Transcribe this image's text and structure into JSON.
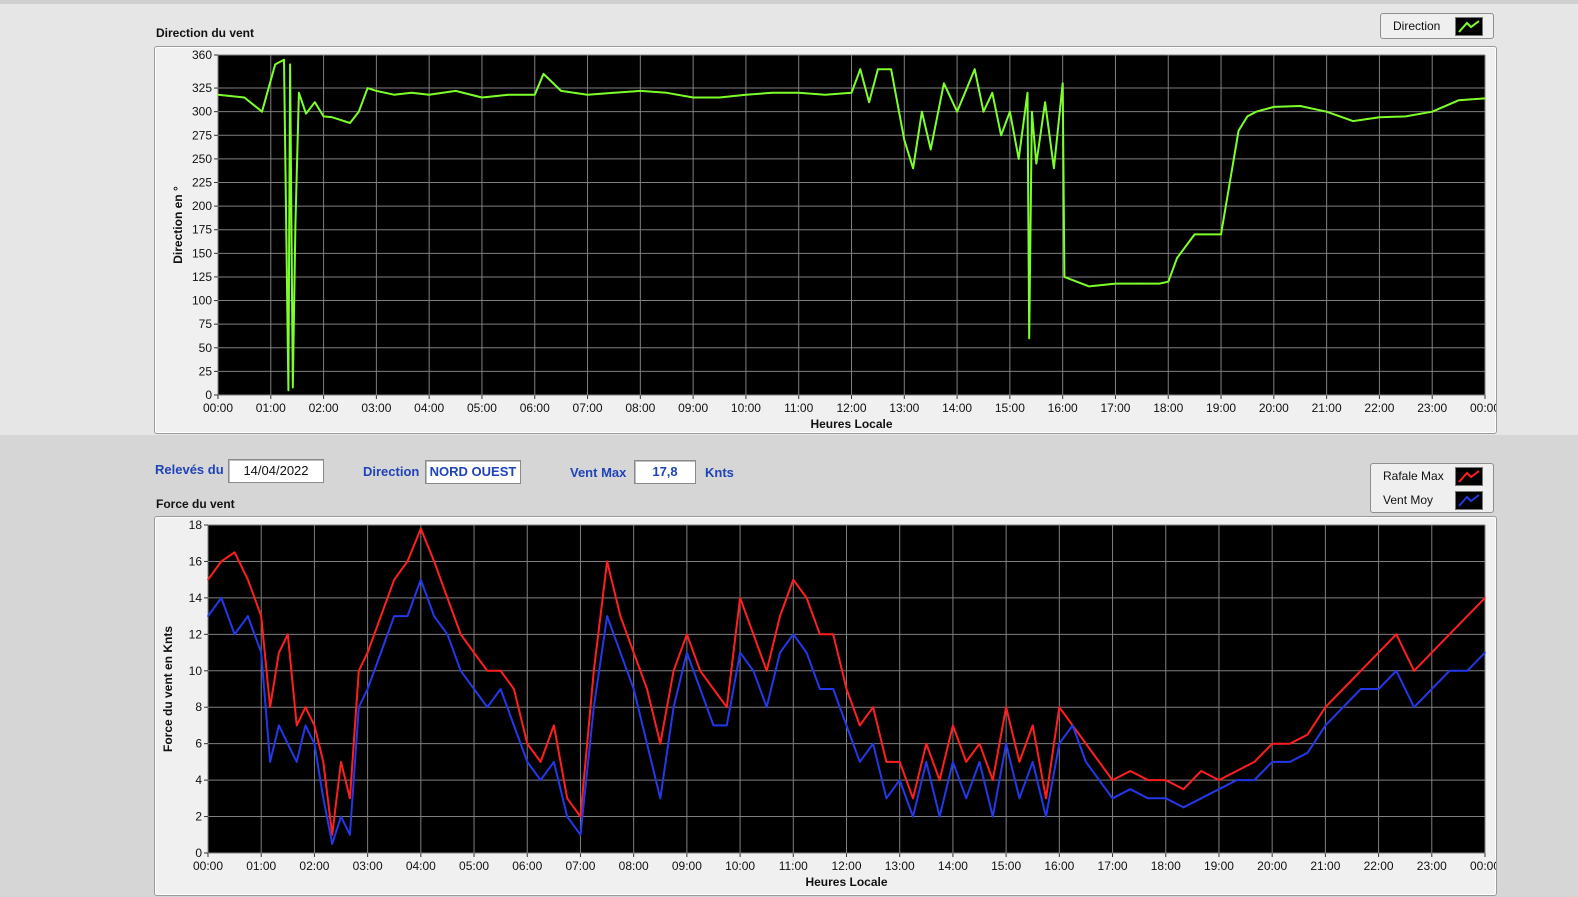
{
  "colors": {
    "direction": "#7dff2a",
    "rafale": "#ff1f1f",
    "moy": "#2338e8",
    "plot_bg": "#000000",
    "grid": "#7f7f7f",
    "label_blue": "#1f43b8"
  },
  "panels": {
    "direction_title": "Direction du vent",
    "force_title": "Force du vent"
  },
  "info": {
    "releves_label": "Relevés du",
    "date": "14/04/2022",
    "direction_label": "Direction",
    "direction_value": "NORD OUEST",
    "ventmax_label": "Vent Max",
    "ventmax_value": "17,8",
    "ventmax_unit": "Knts"
  },
  "legends": {
    "direction": {
      "label": "Direction",
      "icon": "line-swatch-icon"
    },
    "rafale": {
      "label": "Rafale Max",
      "icon": "line-swatch-icon"
    },
    "moy": {
      "label": "Vent Moy",
      "icon": "line-swatch-icon"
    }
  },
  "chart_data": [
    {
      "type": "line",
      "title": "Direction du vent",
      "xlabel": "Heures Locale",
      "ylabel": "Direction en °",
      "xlim": [
        "00:00",
        "24:00"
      ],
      "ylim": [
        0,
        360
      ],
      "grid": true,
      "legend_position": "top-right",
      "x_ticks": [
        "00:00",
        "01:00",
        "02:00",
        "03:00",
        "04:00",
        "05:00",
        "06:00",
        "07:00",
        "08:00",
        "09:00",
        "10:00",
        "11:00",
        "12:00",
        "13:00",
        "14:00",
        "15:00",
        "16:00",
        "17:00",
        "18:00",
        "19:00",
        "20:00",
        "21:00",
        "22:00",
        "23:00",
        "00:00"
      ],
      "y_ticks": [
        0,
        25,
        50,
        75,
        100,
        125,
        150,
        175,
        200,
        225,
        250,
        275,
        300,
        325,
        360
      ],
      "series": [
        {
          "name": "Direction",
          "x": [
            "00:00",
            "00:30",
            "00:50",
            "01:05",
            "01:15",
            "01:20",
            "01:22",
            "01:25",
            "01:28",
            "01:32",
            "01:40",
            "01:50",
            "02:00",
            "02:10",
            "02:30",
            "02:40",
            "02:50",
            "03:00",
            "03:20",
            "03:40",
            "04:00",
            "04:30",
            "05:00",
            "05:30",
            "06:00",
            "06:10",
            "06:30",
            "07:00",
            "07:30",
            "08:00",
            "08:30",
            "09:00",
            "09:30",
            "10:00",
            "10:30",
            "11:00",
            "11:30",
            "12:00",
            "12:10",
            "12:20",
            "12:30",
            "12:45",
            "13:00",
            "13:10",
            "13:20",
            "13:30",
            "13:45",
            "14:00",
            "14:20",
            "14:30",
            "14:40",
            "14:50",
            "15:00",
            "15:10",
            "15:20",
            "15:22",
            "15:25",
            "15:30",
            "15:40",
            "15:50",
            "16:00",
            "16:02",
            "16:30",
            "17:00",
            "17:30",
            "17:50",
            "18:00",
            "18:10",
            "18:30",
            "19:00",
            "19:10",
            "19:20",
            "19:30",
            "19:40",
            "20:00",
            "20:30",
            "21:00",
            "21:30",
            "22:00",
            "22:30",
            "23:00",
            "23:30",
            "24:00"
          ],
          "values": [
            318,
            315,
            300,
            350,
            355,
            5,
            350,
            8,
            180,
            320,
            298,
            310,
            295,
            294,
            288,
            300,
            325,
            322,
            318,
            320,
            318,
            322,
            315,
            318,
            318,
            340,
            322,
            318,
            320,
            322,
            320,
            315,
            315,
            318,
            320,
            320,
            318,
            320,
            345,
            310,
            345,
            345,
            270,
            240,
            300,
            260,
            330,
            300,
            345,
            300,
            320,
            275,
            300,
            250,
            320,
            60,
            300,
            245,
            310,
            240,
            330,
            125,
            115,
            118,
            118,
            118,
            120,
            145,
            170,
            170,
            225,
            280,
            295,
            300,
            305,
            306,
            300,
            290,
            294,
            295,
            300,
            312,
            314
          ]
        }
      ]
    },
    {
      "type": "line",
      "title": "Force du vent",
      "xlabel": "Heures Locale",
      "ylabel": "Force du vent en Knts",
      "xlim": [
        "00:00",
        "24:00"
      ],
      "ylim": [
        0,
        18
      ],
      "grid": true,
      "legend_position": "top-right",
      "x_ticks": [
        "00:00",
        "01:00",
        "02:00",
        "03:00",
        "04:00",
        "05:00",
        "06:00",
        "07:00",
        "08:00",
        "09:00",
        "10:00",
        "11:00",
        "12:00",
        "13:00",
        "14:00",
        "15:00",
        "16:00",
        "17:00",
        "18:00",
        "19:00",
        "20:00",
        "21:00",
        "22:00",
        "23:00",
        "00:00"
      ],
      "y_ticks": [
        0,
        2,
        4,
        6,
        8,
        10,
        12,
        14,
        16,
        18
      ],
      "series": [
        {
          "name": "Rafale Max",
          "x": [
            "00:00",
            "00:15",
            "00:30",
            "00:45",
            "01:00",
            "01:10",
            "01:20",
            "01:30",
            "01:40",
            "01:50",
            "02:00",
            "02:10",
            "02:20",
            "02:30",
            "02:40",
            "02:50",
            "03:00",
            "03:15",
            "03:30",
            "03:45",
            "04:00",
            "04:15",
            "04:30",
            "04:45",
            "05:00",
            "05:15",
            "05:30",
            "05:45",
            "06:00",
            "06:15",
            "06:30",
            "06:45",
            "07:00",
            "07:15",
            "07:30",
            "07:45",
            "08:00",
            "08:15",
            "08:30",
            "08:45",
            "09:00",
            "09:15",
            "09:30",
            "09:45",
            "10:00",
            "10:15",
            "10:30",
            "10:45",
            "11:00",
            "11:15",
            "11:30",
            "11:45",
            "12:00",
            "12:15",
            "12:30",
            "12:45",
            "13:00",
            "13:15",
            "13:30",
            "13:45",
            "14:00",
            "14:15",
            "14:30",
            "14:45",
            "15:00",
            "15:15",
            "15:30",
            "15:45",
            "16:00",
            "16:15",
            "16:30",
            "16:45",
            "17:00",
            "17:20",
            "17:40",
            "18:00",
            "18:20",
            "18:40",
            "19:00",
            "19:20",
            "19:40",
            "20:00",
            "20:20",
            "20:40",
            "21:00",
            "21:20",
            "21:40",
            "22:00",
            "22:20",
            "22:40",
            "23:00",
            "23:20",
            "23:40",
            "24:00"
          ],
          "values": [
            15,
            16,
            16.5,
            15,
            13,
            8,
            11,
            12,
            7,
            8,
            7,
            5,
            1,
            5,
            3,
            10,
            11,
            13,
            15,
            16,
            17.8,
            16,
            14,
            12,
            11,
            10,
            10,
            9,
            6,
            5,
            7,
            3,
            2,
            10,
            16,
            13,
            11,
            9,
            6,
            10,
            12,
            10,
            9,
            8,
            14,
            12,
            10,
            13,
            15,
            14,
            12,
            12,
            9,
            7,
            8,
            5,
            5,
            3,
            6,
            4,
            7,
            5,
            6,
            4,
            8,
            5,
            7,
            3,
            8,
            7,
            6,
            5,
            4,
            4.5,
            4,
            4,
            3.5,
            4.5,
            4,
            4.5,
            5,
            6,
            6,
            6.5,
            8,
            9,
            10,
            11,
            12,
            10,
            11,
            12,
            13,
            14
          ]
        },
        {
          "name": "Vent Moy",
          "x": [
            "00:00",
            "00:15",
            "00:30",
            "00:45",
            "01:00",
            "01:10",
            "01:20",
            "01:30",
            "01:40",
            "01:50",
            "02:00",
            "02:10",
            "02:20",
            "02:30",
            "02:40",
            "02:50",
            "03:00",
            "03:15",
            "03:30",
            "03:45",
            "04:00",
            "04:15",
            "04:30",
            "04:45",
            "05:00",
            "05:15",
            "05:30",
            "05:45",
            "06:00",
            "06:15",
            "06:30",
            "06:45",
            "07:00",
            "07:15",
            "07:30",
            "07:45",
            "08:00",
            "08:15",
            "08:30",
            "08:45",
            "09:00",
            "09:15",
            "09:30",
            "09:45",
            "10:00",
            "10:15",
            "10:30",
            "10:45",
            "11:00",
            "11:15",
            "11:30",
            "11:45",
            "12:00",
            "12:15",
            "12:30",
            "12:45",
            "13:00",
            "13:15",
            "13:30",
            "13:45",
            "14:00",
            "14:15",
            "14:30",
            "14:45",
            "15:00",
            "15:15",
            "15:30",
            "15:45",
            "16:00",
            "16:15",
            "16:30",
            "16:45",
            "17:00",
            "17:20",
            "17:40",
            "18:00",
            "18:20",
            "18:40",
            "19:00",
            "19:20",
            "19:40",
            "20:00",
            "20:20",
            "20:40",
            "21:00",
            "21:20",
            "21:40",
            "22:00",
            "22:20",
            "22:40",
            "23:00",
            "23:20",
            "23:40",
            "24:00"
          ],
          "values": [
            13,
            14,
            12,
            13,
            11,
            5,
            7,
            6,
            5,
            7,
            6,
            3,
            0.5,
            2,
            1,
            8,
            9,
            11,
            13,
            13,
            15,
            13,
            12,
            10,
            9,
            8,
            9,
            7,
            5,
            4,
            5,
            2,
            1,
            8,
            13,
            11,
            9,
            6,
            3,
            8,
            11,
            9,
            7,
            7,
            11,
            10,
            8,
            11,
            12,
            11,
            9,
            9,
            7,
            5,
            6,
            3,
            4,
            2,
            5,
            2,
            5,
            3,
            5,
            2,
            6,
            3,
            5,
            2,
            6,
            7,
            5,
            4,
            3,
            3.5,
            3,
            3,
            2.5,
            3,
            3.5,
            4,
            4,
            5,
            5,
            5.5,
            7,
            8,
            9,
            9,
            10,
            8,
            9,
            10,
            10,
            11
          ]
        }
      ]
    }
  ]
}
